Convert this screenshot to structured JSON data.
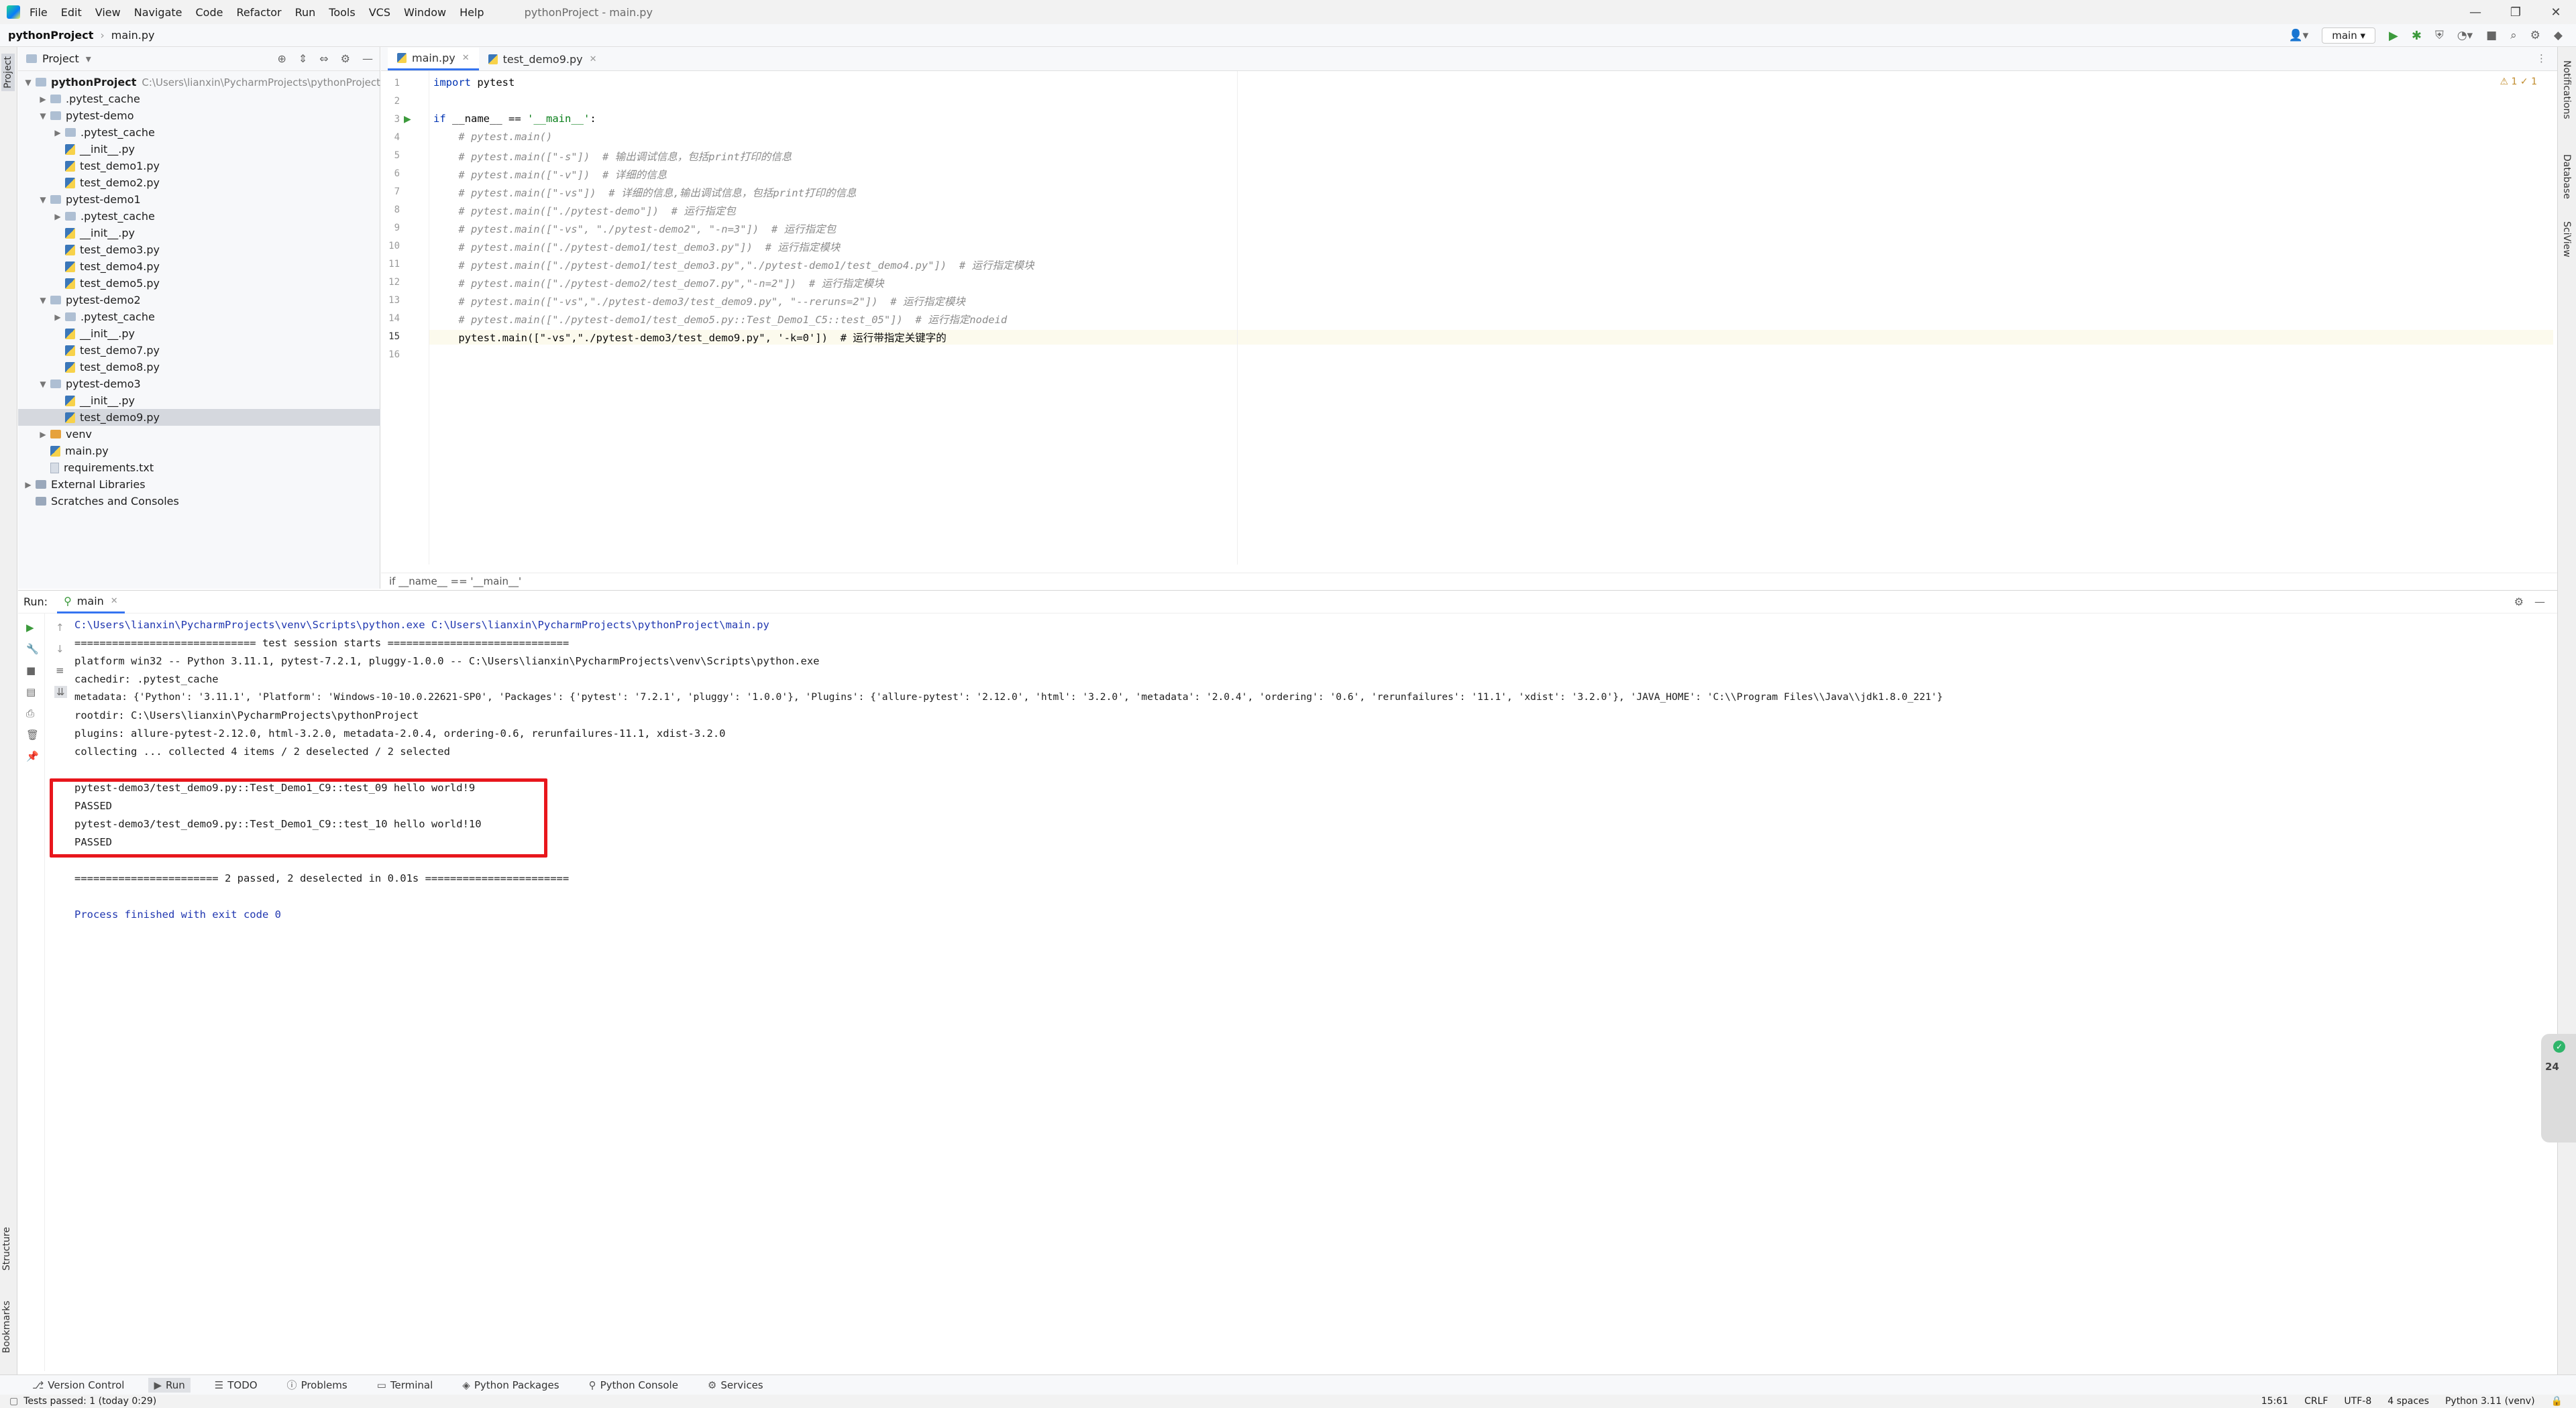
{
  "menubar": {
    "items": [
      "File",
      "Edit",
      "View",
      "Navigate",
      "Code",
      "Refactor",
      "Run",
      "Tools",
      "VCS",
      "Window",
      "Help"
    ],
    "window_title": "pythonProject - main.py"
  },
  "navbar": {
    "project": "pythonProject",
    "file": "main.py",
    "run_config": "main"
  },
  "project_panel": {
    "title": "Project",
    "tree": [
      {
        "label": "pythonProject",
        "path": "C:\\Users\\lianxin\\PycharmProjects\\pythonProject",
        "type": "root"
      },
      {
        "label": ".pytest_cache",
        "type": "folder"
      },
      {
        "label": "pytest-demo",
        "type": "folder"
      },
      {
        "label": ".pytest_cache",
        "type": "folder"
      },
      {
        "label": "__init__.py",
        "type": "py"
      },
      {
        "label": "test_demo1.py",
        "type": "py"
      },
      {
        "label": "test_demo2.py",
        "type": "py"
      },
      {
        "label": "pytest-demo1",
        "type": "folder"
      },
      {
        "label": ".pytest_cache",
        "type": "folder"
      },
      {
        "label": "__init__.py",
        "type": "py"
      },
      {
        "label": "test_demo3.py",
        "type": "py"
      },
      {
        "label": "test_demo4.py",
        "type": "py"
      },
      {
        "label": "test_demo5.py",
        "type": "py"
      },
      {
        "label": "pytest-demo2",
        "type": "folder"
      },
      {
        "label": ".pytest_cache",
        "type": "folder"
      },
      {
        "label": "__init__.py",
        "type": "py"
      },
      {
        "label": "test_demo7.py",
        "type": "py"
      },
      {
        "label": "test_demo8.py",
        "type": "py"
      },
      {
        "label": "pytest-demo3",
        "type": "folder"
      },
      {
        "label": "__init__.py",
        "type": "py"
      },
      {
        "label": "test_demo9.py",
        "type": "py"
      },
      {
        "label": "venv",
        "type": "folder-orange"
      },
      {
        "label": "main.py",
        "type": "py"
      },
      {
        "label": "requirements.txt",
        "type": "txt"
      },
      {
        "label": "External Libraries",
        "type": "lib"
      },
      {
        "label": "Scratches and Consoles",
        "type": "scratch"
      }
    ]
  },
  "editor": {
    "tabs": [
      {
        "label": "main.py",
        "active": true
      },
      {
        "label": "test_demo9.py",
        "active": false
      }
    ],
    "inspection": "⚠ 1  ✓ 1",
    "breadcrumb": "if __name__ == '__main__'",
    "lines": [
      "import pytest",
      "",
      "if __name__ == '__main__':",
      "    # pytest.main()",
      "    # pytest.main([\"-s\"])  # 输出调试信息，包括print打印的信息",
      "    # pytest.main([\"-v\"])  # 详细的信息",
      "    # pytest.main([\"-vs\"])  # 详细的信息,输出调试信息，包括print打印的信息",
      "    # pytest.main([\"./pytest-demo\"])  # 运行指定包",
      "    # pytest.main([\"-vs\", \"./pytest-demo2\", \"-n=3\"])  # 运行指定包",
      "    # pytest.main([\"./pytest-demo1/test_demo3.py\"])  # 运行指定模块",
      "    # pytest.main([\"./pytest-demo1/test_demo3.py\",\"./pytest-demo1/test_demo4.py\"])  # 运行指定模块",
      "    # pytest.main([\"./pytest-demo2/test_demo7.py\",\"-n=2\"])  # 运行指定模块",
      "    # pytest.main([\"-vs\",\"./pytest-demo3/test_demo9.py\", \"--reruns=2\"])  # 运行指定模块",
      "    # pytest.main([\"./pytest-demo1/test_demo5.py::Test_Demo1_C5::test_05\"])  # 运行指定nodeid",
      "    pytest.main([\"-vs\",\"./pytest-demo3/test_demo9.py\", '-k=0'])  # 运行带指定关键字的",
      ""
    ]
  },
  "run_panel": {
    "label": "Run:",
    "tab": "main",
    "output": [
      "C:\\Users\\lianxin\\PycharmProjects\\venv\\Scripts\\python.exe C:\\Users\\lianxin\\PycharmProjects\\pythonProject\\main.py",
      "============================= test session starts =============================",
      "platform win32 -- Python 3.11.1, pytest-7.2.1, pluggy-1.0.0 -- C:\\Users\\lianxin\\PycharmProjects\\venv\\Scripts\\python.exe",
      "cachedir: .pytest_cache",
      "metadata: {'Python': '3.11.1', 'Platform': 'Windows-10-10.0.22621-SP0', 'Packages': {'pytest': '7.2.1', 'pluggy': '1.0.0'}, 'Plugins': {'allure-pytest': '2.12.0', 'html': '3.2.0', 'metadata': '2.0.4', 'ordering': '0.6', 'rerunfailures': '11.1', 'xdist': '3.2.0'}, 'JAVA_HOME': 'C:\\\\Program Files\\\\Java\\\\jdk1.8.0_221'}",
      "rootdir: C:\\Users\\lianxin\\PycharmProjects\\pythonProject",
      "plugins: allure-pytest-2.12.0, html-3.2.0, metadata-2.0.4, ordering-0.6, rerunfailures-11.1, xdist-3.2.0",
      "collecting ... collected 4 items / 2 deselected / 2 selected",
      "",
      "pytest-demo3/test_demo9.py::Test_Demo1_C9::test_09 hello world!9",
      "PASSED",
      "pytest-demo3/test_demo9.py::Test_Demo1_C9::test_10 hello world!10",
      "PASSED",
      "",
      "======================= 2 passed, 2 deselected in 0.01s =======================",
      "",
      "Process finished with exit code 0"
    ]
  },
  "bottom_tabs": [
    "Version Control",
    "Run",
    "TODO",
    "Problems",
    "Terminal",
    "Python Packages",
    "Python Console",
    "Services"
  ],
  "status": {
    "left": "Tests passed: 1 (today 0:29)",
    "position": "15:61",
    "line_sep": "CRLF",
    "encoding": "UTF-8",
    "indent": "4 spaces",
    "interpreter": "Python 3.11 (venv)"
  },
  "side_labels": {
    "left_top": "Project",
    "left_bottom1": "Structure",
    "left_bottom2": "Bookmarks",
    "right1": "Notifications",
    "right2": "Database",
    "right3": "SciView"
  },
  "widget": {
    "value": "24"
  }
}
